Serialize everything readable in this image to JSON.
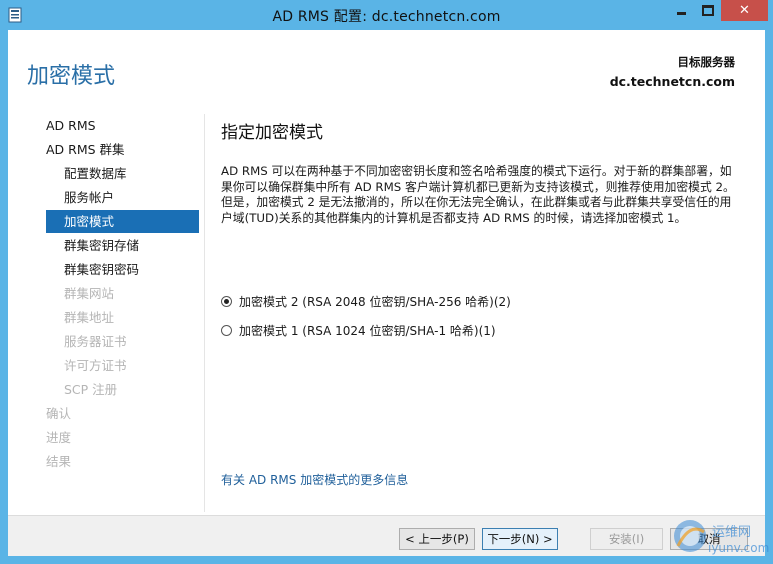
{
  "window": {
    "title": "AD RMS 配置: dc.technetcn.com",
    "controls": {
      "minimize": "minimize",
      "maximize": "maximize",
      "close": "✕"
    }
  },
  "header": {
    "page_title": "加密模式",
    "target_label": "目标服务器",
    "target_server": "dc.technetcn.com"
  },
  "sidebar": {
    "items": [
      {
        "label": "AD RMS",
        "level": "top",
        "state": "normal"
      },
      {
        "label": "AD RMS 群集",
        "level": "top",
        "state": "normal"
      },
      {
        "label": "配置数据库",
        "level": "sub",
        "state": "normal"
      },
      {
        "label": "服务帐户",
        "level": "sub",
        "state": "normal"
      },
      {
        "label": "加密模式",
        "level": "sub",
        "state": "selected"
      },
      {
        "label": "群集密钥存储",
        "level": "sub",
        "state": "normal"
      },
      {
        "label": "群集密钥密码",
        "level": "sub",
        "state": "normal"
      },
      {
        "label": "群集网站",
        "level": "sub",
        "state": "disabled"
      },
      {
        "label": "群集地址",
        "level": "sub",
        "state": "disabled"
      },
      {
        "label": "服务器证书",
        "level": "sub",
        "state": "disabled"
      },
      {
        "label": "许可方证书",
        "level": "sub",
        "state": "disabled"
      },
      {
        "label": "SCP 注册",
        "level": "sub",
        "state": "disabled"
      },
      {
        "label": "确认",
        "level": "top",
        "state": "disabled"
      },
      {
        "label": "进度",
        "level": "top",
        "state": "disabled"
      },
      {
        "label": "结果",
        "level": "top",
        "state": "disabled"
      }
    ]
  },
  "main": {
    "section_title": "指定加密模式",
    "description": "AD RMS 可以在两种基于不同加密密钥长度和签名哈希强度的模式下运行。对于新的群集部署，如果你可以确保群集中所有 AD RMS 客户端计算机都已更新为支持该模式，则推荐使用加密模式 2。但是，加密模式 2 是无法撤消的，所以在你无法完全确认，在此群集或者与此群集共享受信任的用户域(TUD)关系的其他群集内的计算机是否都支持 AD RMS 的时候，请选择加密模式 1。",
    "options": [
      {
        "label": "加密模式 2 (RSA 2048 位密钥/SHA-256 哈希)(2)",
        "selected": true
      },
      {
        "label": "加密模式 1 (RSA 1024 位密钥/SHA-1 哈希)(1)",
        "selected": false
      }
    ],
    "more_info_link": "有关 AD RMS 加密模式的更多信息"
  },
  "footer": {
    "prev": "< 上一步(P)",
    "next": "下一步(N) >",
    "install": "安装(I)",
    "cancel": "取消"
  },
  "watermark": {
    "line1": "运维网",
    "line2": "iyunv.com"
  },
  "colors": {
    "title_bar": "#5ab4e6",
    "close_button": "#c7504a",
    "accent": "#1a6fb5",
    "page_title": "#2a6fa7",
    "link": "#1f5f9a",
    "disabled_text": "#b5b5b5"
  }
}
